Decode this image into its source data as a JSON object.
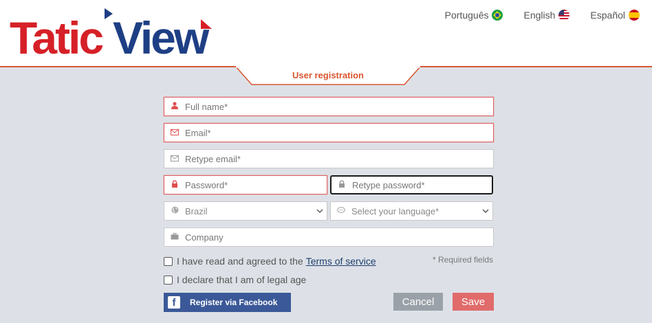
{
  "header": {
    "logo_text": "TaticView",
    "languages": [
      {
        "label": "Português",
        "flag": "brazil-flag-icon"
      },
      {
        "label": "English",
        "flag": "usa-flag-icon"
      },
      {
        "label": "Español",
        "flag": "spain-flag-icon"
      }
    ]
  },
  "tab": {
    "label": "User registration"
  },
  "form": {
    "full_name": {
      "placeholder": "Full name*",
      "icon": "user-icon"
    },
    "email": {
      "placeholder": "Email*",
      "icon": "envelope-icon"
    },
    "retype_email": {
      "placeholder": "Retype email*",
      "icon": "envelope-icon"
    },
    "password": {
      "placeholder": "Password*",
      "icon": "lock-icon"
    },
    "retype_password": {
      "placeholder": "Retype password*",
      "icon": "lock-icon"
    },
    "country": {
      "value": "Brazil",
      "icon": "globe-icon"
    },
    "language": {
      "value": "Select your language*",
      "icon": "chat-icon"
    },
    "company": {
      "placeholder": "Company",
      "icon": "briefcase-icon"
    },
    "terms_text": "I have read and agreed to the",
    "terms_link": "Terms of service",
    "legal_age_text": "I declare that I am of legal age",
    "required_note": "* Required fields"
  },
  "buttons": {
    "facebook": "Register via Facebook",
    "cancel": "Cancel",
    "save": "Save"
  },
  "colors": {
    "accent": "#d9562f",
    "brand_red": "#d62027",
    "brand_blue": "#1e3f85",
    "facebook": "#3b5998",
    "save": "#e16b6b",
    "cancel": "#9aa1a9",
    "error_border": "#e06060"
  }
}
